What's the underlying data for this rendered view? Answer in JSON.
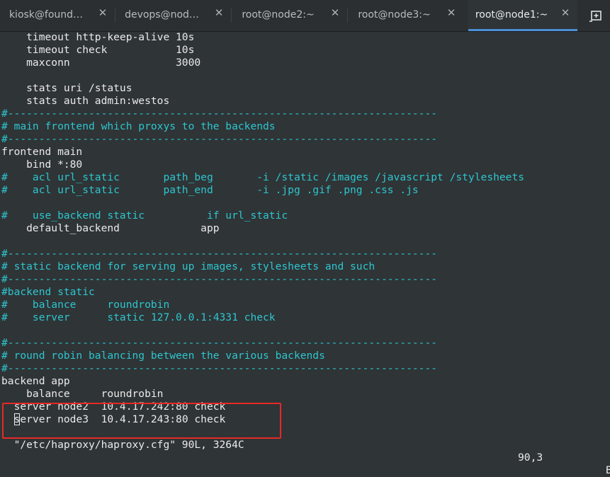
{
  "tabs": [
    {
      "label": "kiosk@found…"
    },
    {
      "label": "devops@nod…"
    },
    {
      "label": "root@node2:~"
    },
    {
      "label": "root@node3:~"
    },
    {
      "label": "root@node1:~"
    }
  ],
  "active_tab": "root@node1:~",
  "icons": {
    "close": "close-icon",
    "new_tab": "new-tab-icon"
  },
  "colors": {
    "comment": "#2dc6cf",
    "text": "#eaeaea",
    "highlight_box": "#e52a27",
    "active_tab_underline": "#4a90d9"
  },
  "terminal": {
    "lines": [
      {
        "text": "    timeout http-keep-alive 10s",
        "comment": false
      },
      {
        "text": "    timeout check           10s",
        "comment": false
      },
      {
        "text": "    maxconn                 3000",
        "comment": false
      },
      {
        "text": "",
        "comment": false
      },
      {
        "text": "    stats uri /status",
        "comment": false
      },
      {
        "text": "    stats auth admin:westos",
        "comment": false
      },
      {
        "text": "#---------------------------------------------------------------------",
        "comment": true
      },
      {
        "text": "# main frontend which proxys to the backends",
        "comment": true
      },
      {
        "text": "#---------------------------------------------------------------------",
        "comment": true
      },
      {
        "text": "frontend main",
        "comment": false
      },
      {
        "text": "    bind *:80",
        "comment": false
      },
      {
        "text": "#    acl url_static       path_beg       -i /static /images /javascript /stylesheets",
        "comment": true
      },
      {
        "text": "#    acl url_static       path_end       -i .jpg .gif .png .css .js",
        "comment": true
      },
      {
        "text": "",
        "comment": false
      },
      {
        "text": "#    use_backend static          if url_static",
        "comment": true
      },
      {
        "text": "    default_backend             app",
        "comment": false
      },
      {
        "text": "",
        "comment": false
      },
      {
        "text": "#---------------------------------------------------------------------",
        "comment": true
      },
      {
        "text": "# static backend for serving up images, stylesheets and such",
        "comment": true
      },
      {
        "text": "#---------------------------------------------------------------------",
        "comment": true
      },
      {
        "text": "#backend static",
        "comment": true
      },
      {
        "text": "#    balance     roundrobin",
        "comment": true
      },
      {
        "text": "#    server      static 127.0.0.1:4331 check",
        "comment": true
      },
      {
        "text": "",
        "comment": false
      },
      {
        "text": "#---------------------------------------------------------------------",
        "comment": true
      },
      {
        "text": "# round robin balancing between the various backends",
        "comment": true
      },
      {
        "text": "#---------------------------------------------------------------------",
        "comment": true
      },
      {
        "text": "backend app",
        "comment": false
      },
      {
        "text": "    balance     roundrobin",
        "comment": false
      },
      {
        "text": "  server node2  10.4.17.242:80 check",
        "comment": false
      }
    ],
    "cursor_line": {
      "before": "  ",
      "cursor_char": "s",
      "after": "erver node3  10.4.17.243:80 check"
    }
  },
  "status_bar": {
    "file_info": "\"/etc/haproxy/haproxy.cfg\" 90L, 3264C",
    "position": "90,3",
    "scroll_indicator": "B"
  }
}
